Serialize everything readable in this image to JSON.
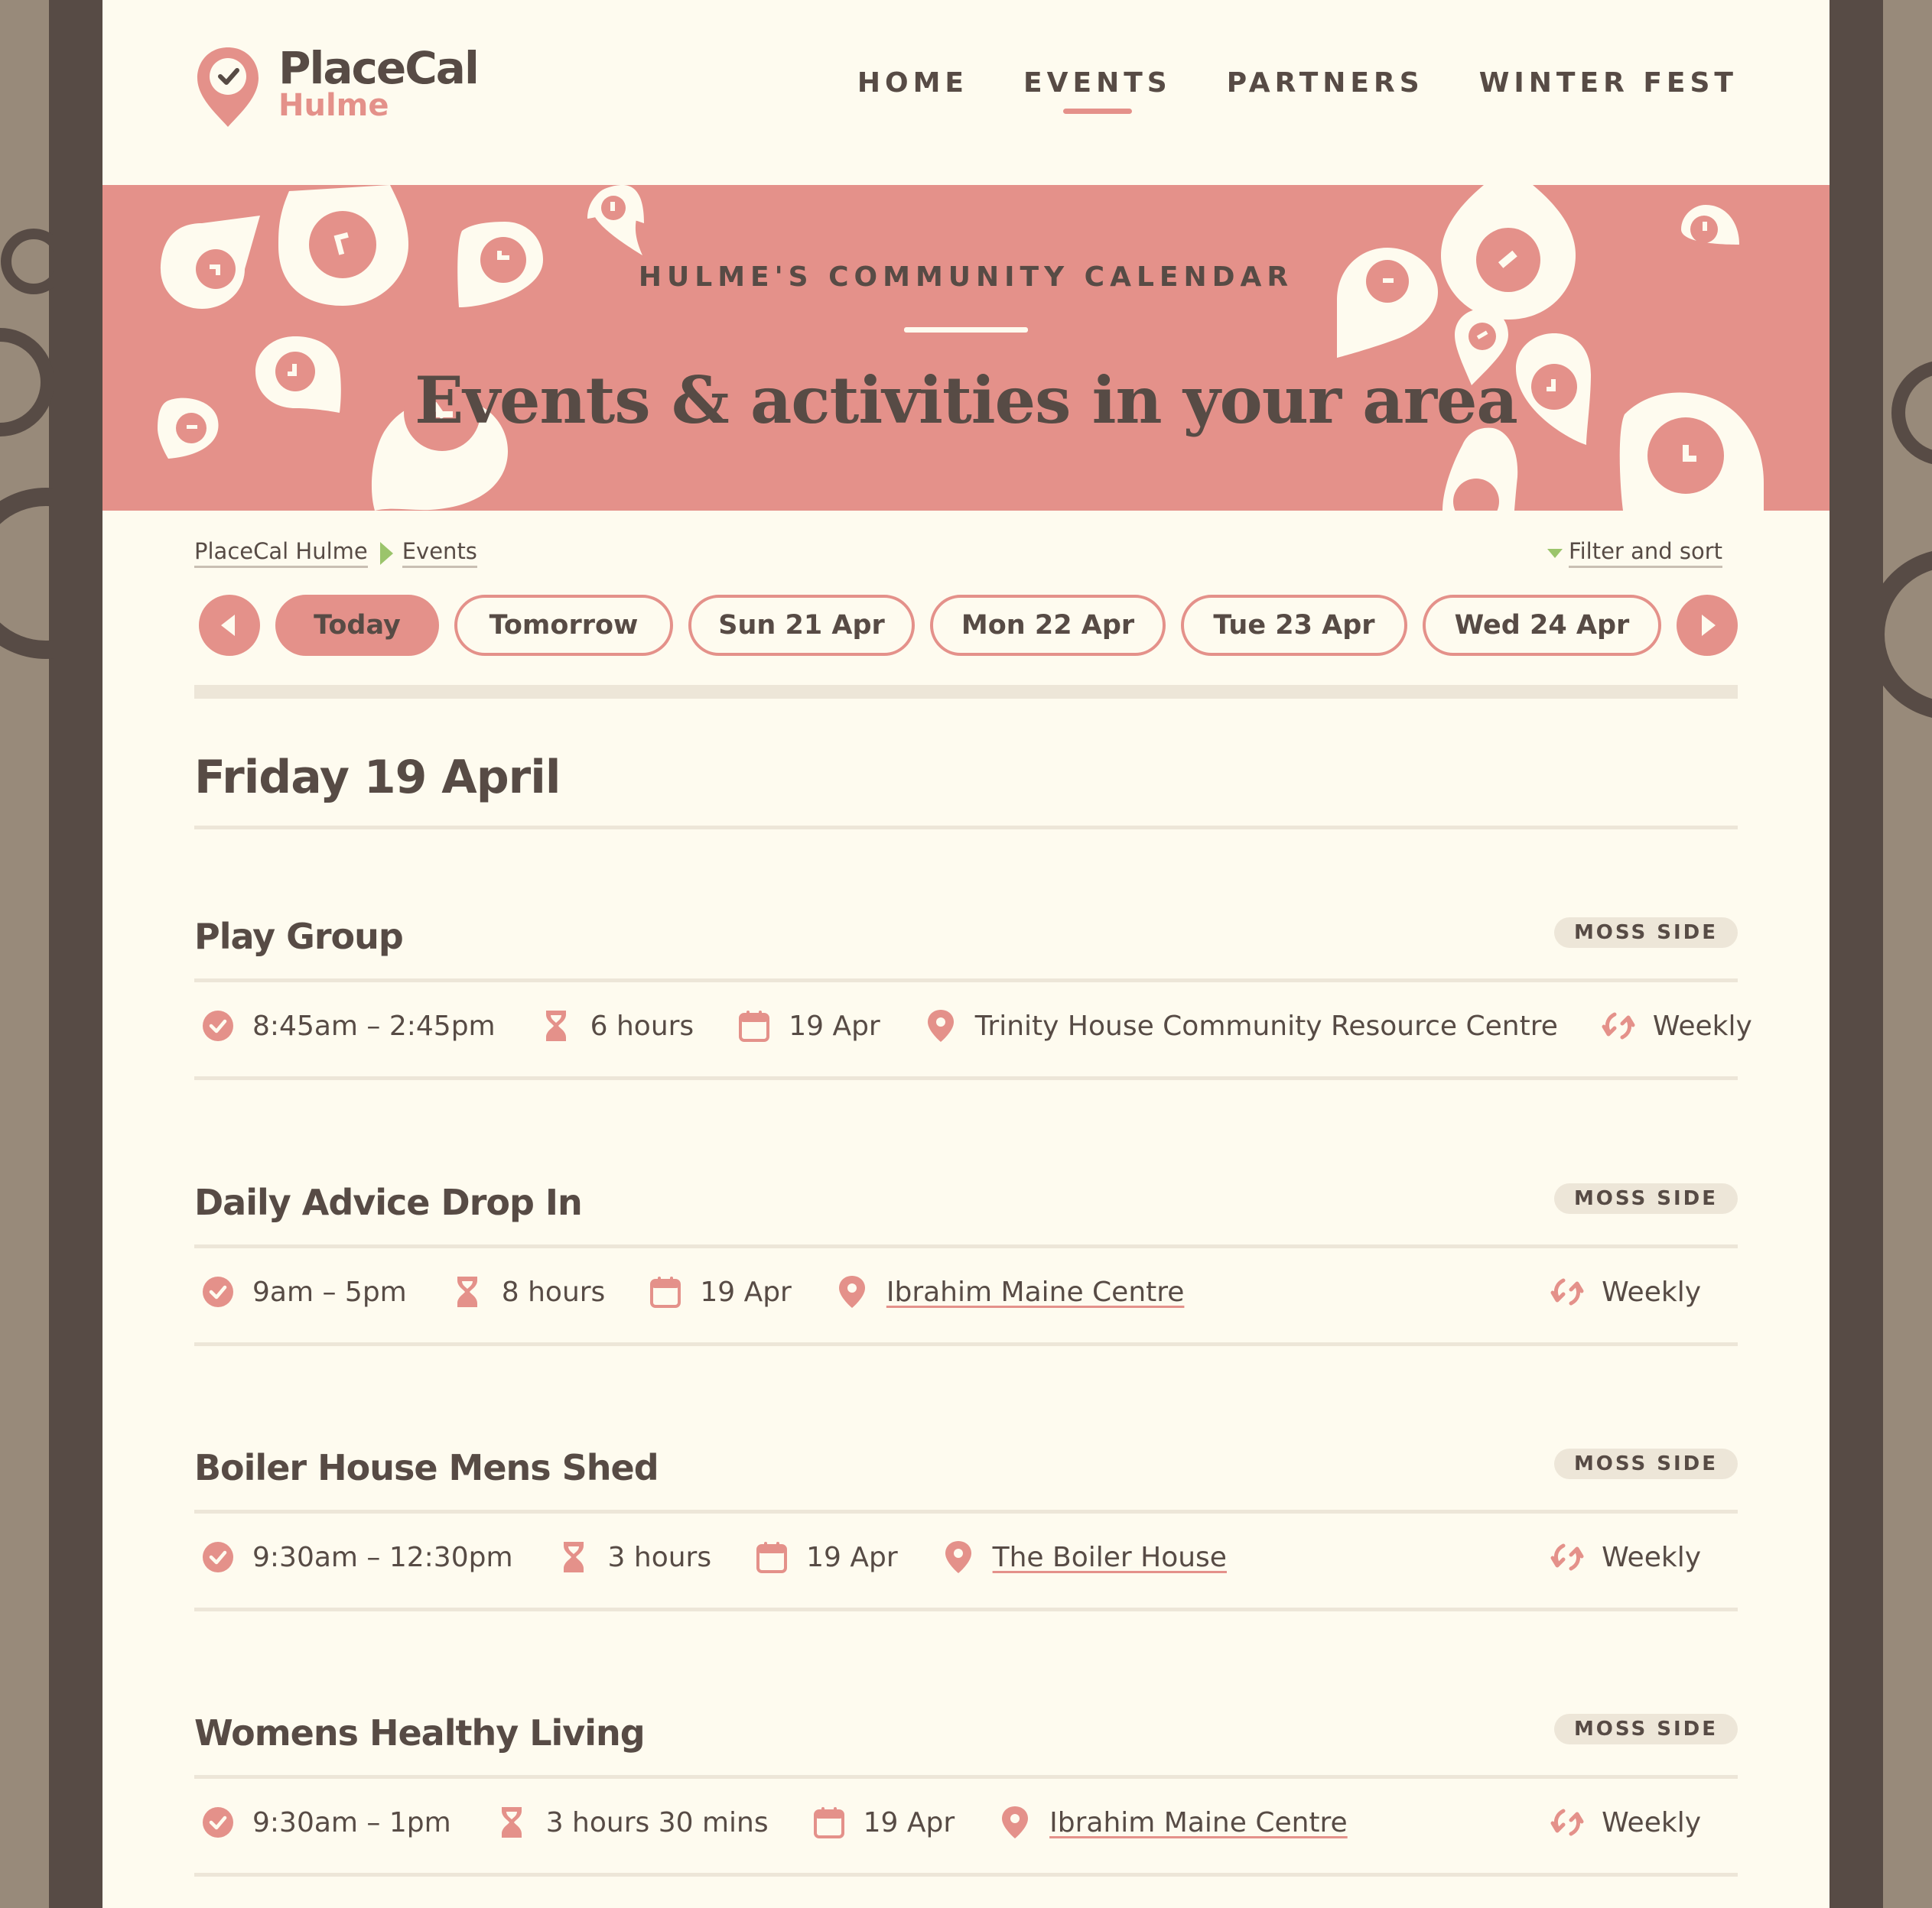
{
  "brand": {
    "name": "PlaceCal",
    "sub": "Hulme",
    "accent": "#e4918a",
    "text": "#574b45",
    "background": "#fefbef"
  },
  "nav": {
    "items": [
      {
        "label": "HOME",
        "active": false
      },
      {
        "label": "EVENTS",
        "active": true
      },
      {
        "label": "PARTNERS",
        "active": false
      },
      {
        "label": "WINTER FEST",
        "active": false
      }
    ]
  },
  "hero": {
    "kicker": "HULME'S COMMUNITY CALENDAR",
    "title": "Events & activities in your area"
  },
  "breadcrumb": {
    "items": [
      "PlaceCal Hulme",
      "Events"
    ]
  },
  "filter": {
    "label": "Filter and sort"
  },
  "daypicker": {
    "prev_icon": "chevron-left-icon",
    "next_icon": "chevron-right-icon",
    "days": [
      {
        "label": "Today",
        "active": true
      },
      {
        "label": "Tomorrow",
        "active": false
      },
      {
        "label": "Sun 21 Apr",
        "active": false
      },
      {
        "label": "Mon 22 Apr",
        "active": false
      },
      {
        "label": "Tue 23 Apr",
        "active": false
      },
      {
        "label": "Wed 24 Apr",
        "active": false
      }
    ]
  },
  "day_heading": "Friday 19 April",
  "events": [
    {
      "title": "Play Group",
      "neighbourhood": "MOSS SIDE",
      "time": "8:45am – 2:45pm",
      "duration": "6 hours",
      "date": "19 Apr",
      "place": "Trinity House Community Resource Centre",
      "place_linked": false,
      "repeat": "Weekly"
    },
    {
      "title": "Daily Advice Drop In",
      "neighbourhood": "MOSS SIDE",
      "time": "9am – 5pm",
      "duration": "8 hours",
      "date": "19 Apr",
      "place": "Ibrahim Maine Centre",
      "place_linked": true,
      "repeat": "Weekly"
    },
    {
      "title": "Boiler House Mens Shed",
      "neighbourhood": "MOSS SIDE",
      "time": "9:30am – 12:30pm",
      "duration": "3 hours",
      "date": "19 Apr",
      "place": "The Boiler House",
      "place_linked": true,
      "repeat": "Weekly"
    },
    {
      "title": "Womens Healthy Living",
      "neighbourhood": "MOSS SIDE",
      "time": "9:30am – 1pm",
      "duration": "3 hours 30 mins",
      "date": "19 Apr",
      "place": "Ibrahim Maine Centre",
      "place_linked": true,
      "repeat": "Weekly"
    }
  ],
  "icons": {
    "time": "clock-icon",
    "duration": "hourglass-icon",
    "date": "calendar-icon",
    "place": "map-pin-icon",
    "repeat": "repeat-icon"
  }
}
